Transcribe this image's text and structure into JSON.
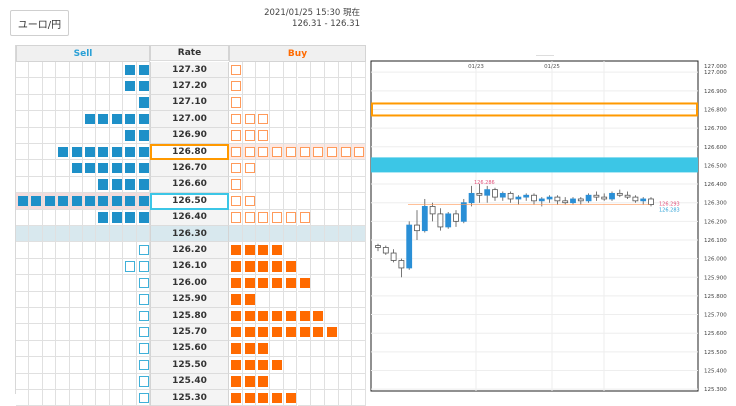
{
  "currency_pair_button": "ユーロ/円",
  "header": {
    "timestamp": "2021/01/25 15:30 現在",
    "bid_ask": "126.31 - 126.31"
  },
  "board": {
    "sell_label": "Sell",
    "rate_label": "Rate",
    "buy_label": "Buy",
    "rows": [
      {
        "rate": "127.30",
        "sell": 2,
        "buy": 1,
        "buy_style": "outline"
      },
      {
        "rate": "127.20",
        "sell": 2,
        "buy": 1,
        "buy_style": "outline"
      },
      {
        "rate": "127.10",
        "sell": 1,
        "buy": 1,
        "buy_style": "outline"
      },
      {
        "rate": "127.00",
        "sell": 5,
        "buy": 3,
        "buy_style": "outline"
      },
      {
        "rate": "126.90",
        "sell": 2,
        "buy": 3,
        "buy_style": "outline"
      },
      {
        "rate": "126.80",
        "sell": 7,
        "buy": 10,
        "buy_style": "outline",
        "selected": "high"
      },
      {
        "rate": "126.70",
        "sell": 6,
        "buy": 2,
        "buy_style": "outline"
      },
      {
        "rate": "126.60",
        "sell": 4,
        "buy": 1,
        "buy_style": "outline"
      },
      {
        "rate": "126.50",
        "sell": 10,
        "buy": 2,
        "buy_style": "outline",
        "selected": "low"
      },
      {
        "rate": "126.40",
        "sell": 4,
        "buy": 6,
        "buy_style": "outline"
      },
      {
        "rate": "126.30",
        "sell": 0,
        "buy": 0,
        "current": true
      },
      {
        "rate": "126.20",
        "sell": 1,
        "sell_style": "outline",
        "buy": 4
      },
      {
        "rate": "126.10",
        "sell": 2,
        "sell_style": "outline",
        "buy": 5
      },
      {
        "rate": "126.00",
        "sell": 1,
        "sell_style": "outline",
        "buy": 6
      },
      {
        "rate": "125.90",
        "sell": 1,
        "sell_style": "outline",
        "buy": 2
      },
      {
        "rate": "125.80",
        "sell": 1,
        "sell_style": "outline",
        "buy": 7
      },
      {
        "rate": "125.70",
        "sell": 1,
        "sell_style": "outline",
        "buy": 8
      },
      {
        "rate": "125.60",
        "sell": 1,
        "sell_style": "outline",
        "buy": 3
      },
      {
        "rate": "125.50",
        "sell": 1,
        "sell_style": "outline",
        "buy": 4
      },
      {
        "rate": "125.40",
        "sell": 1,
        "sell_style": "outline",
        "buy": 3
      },
      {
        "rate": "125.30",
        "sell": 1,
        "sell_style": "outline",
        "buy": 5
      }
    ]
  },
  "chart_data": {
    "type": "candlestick",
    "x_labels": [
      "01/23",
      "01/25"
    ],
    "y_ticks": [
      "127.000",
      "126.900",
      "126.800",
      "126.700",
      "126.600",
      "126.500",
      "126.400",
      "126.300",
      "126.200",
      "126.100",
      "126.000",
      "125.900",
      "125.800",
      "125.700",
      "125.600",
      "125.500",
      "125.400",
      "125.300"
    ],
    "top_label": "127.000",
    "ylim": [
      125.29,
      127.06
    ],
    "price_labels": {
      "high": "126.286",
      "current": "126.293",
      "low": "126.283"
    },
    "highlight_high": 126.8,
    "highlight_low": 126.5,
    "candles": [
      {
        "o": 126.07,
        "h": 126.08,
        "l": 126.04,
        "c": 126.06
      },
      {
        "o": 126.06,
        "h": 126.07,
        "l": 126.02,
        "c": 126.03
      },
      {
        "o": 126.03,
        "h": 126.05,
        "l": 125.98,
        "c": 125.99
      },
      {
        "o": 125.99,
        "h": 126.0,
        "l": 125.9,
        "c": 125.95
      },
      {
        "o": 125.95,
        "h": 126.2,
        "l": 125.94,
        "c": 126.18
      },
      {
        "o": 126.18,
        "h": 126.26,
        "l": 126.1,
        "c": 126.15
      },
      {
        "o": 126.15,
        "h": 126.32,
        "l": 126.14,
        "c": 126.28
      },
      {
        "o": 126.28,
        "h": 126.3,
        "l": 126.2,
        "c": 126.24
      },
      {
        "o": 126.24,
        "h": 126.27,
        "l": 126.15,
        "c": 126.17
      },
      {
        "o": 126.17,
        "h": 126.25,
        "l": 126.16,
        "c": 126.24
      },
      {
        "o": 126.24,
        "h": 126.26,
        "l": 126.17,
        "c": 126.2
      },
      {
        "o": 126.2,
        "h": 126.32,
        "l": 126.19,
        "c": 126.3
      },
      {
        "o": 126.3,
        "h": 126.39,
        "l": 126.28,
        "c": 126.35
      },
      {
        "o": 126.35,
        "h": 126.4,
        "l": 126.3,
        "c": 126.34
      },
      {
        "o": 126.34,
        "h": 126.39,
        "l": 126.3,
        "c": 126.37
      },
      {
        "o": 126.37,
        "h": 126.38,
        "l": 126.31,
        "c": 126.33
      },
      {
        "o": 126.33,
        "h": 126.36,
        "l": 126.31,
        "c": 126.35
      },
      {
        "o": 126.35,
        "h": 126.36,
        "l": 126.3,
        "c": 126.32
      },
      {
        "o": 126.32,
        "h": 126.34,
        "l": 126.29,
        "c": 126.33
      },
      {
        "o": 126.33,
        "h": 126.35,
        "l": 126.31,
        "c": 126.34
      },
      {
        "o": 126.34,
        "h": 126.35,
        "l": 126.29,
        "c": 126.31
      },
      {
        "o": 126.31,
        "h": 126.33,
        "l": 126.28,
        "c": 126.32
      },
      {
        "o": 126.32,
        "h": 126.34,
        "l": 126.3,
        "c": 126.33
      },
      {
        "o": 126.33,
        "h": 126.34,
        "l": 126.29,
        "c": 126.31
      },
      {
        "o": 126.31,
        "h": 126.33,
        "l": 126.29,
        "c": 126.3
      },
      {
        "o": 126.3,
        "h": 126.33,
        "l": 126.29,
        "c": 126.32
      },
      {
        "o": 126.32,
        "h": 126.33,
        "l": 126.29,
        "c": 126.31
      },
      {
        "o": 126.31,
        "h": 126.35,
        "l": 126.3,
        "c": 126.34
      },
      {
        "o": 126.34,
        "h": 126.36,
        "l": 126.31,
        "c": 126.33
      },
      {
        "o": 126.33,
        "h": 126.35,
        "l": 126.31,
        "c": 126.32
      },
      {
        "o": 126.32,
        "h": 126.36,
        "l": 126.31,
        "c": 126.35
      },
      {
        "o": 126.35,
        "h": 126.37,
        "l": 126.33,
        "c": 126.34
      },
      {
        "o": 126.34,
        "h": 126.36,
        "l": 126.32,
        "c": 126.33
      },
      {
        "o": 126.33,
        "h": 126.34,
        "l": 126.3,
        "c": 126.31
      },
      {
        "o": 126.31,
        "h": 126.33,
        "l": 126.29,
        "c": 126.32
      },
      {
        "o": 126.32,
        "h": 126.33,
        "l": 126.28,
        "c": 126.29
      }
    ]
  },
  "colors": {
    "sell_blue": "#1e90c8",
    "buy_orange": "#ff6a00",
    "highlight_orange": "#ff9900",
    "highlight_cyan": "#3cc6e6",
    "candle_up": "#2a8fd6",
    "candle_down": "#555555"
  }
}
